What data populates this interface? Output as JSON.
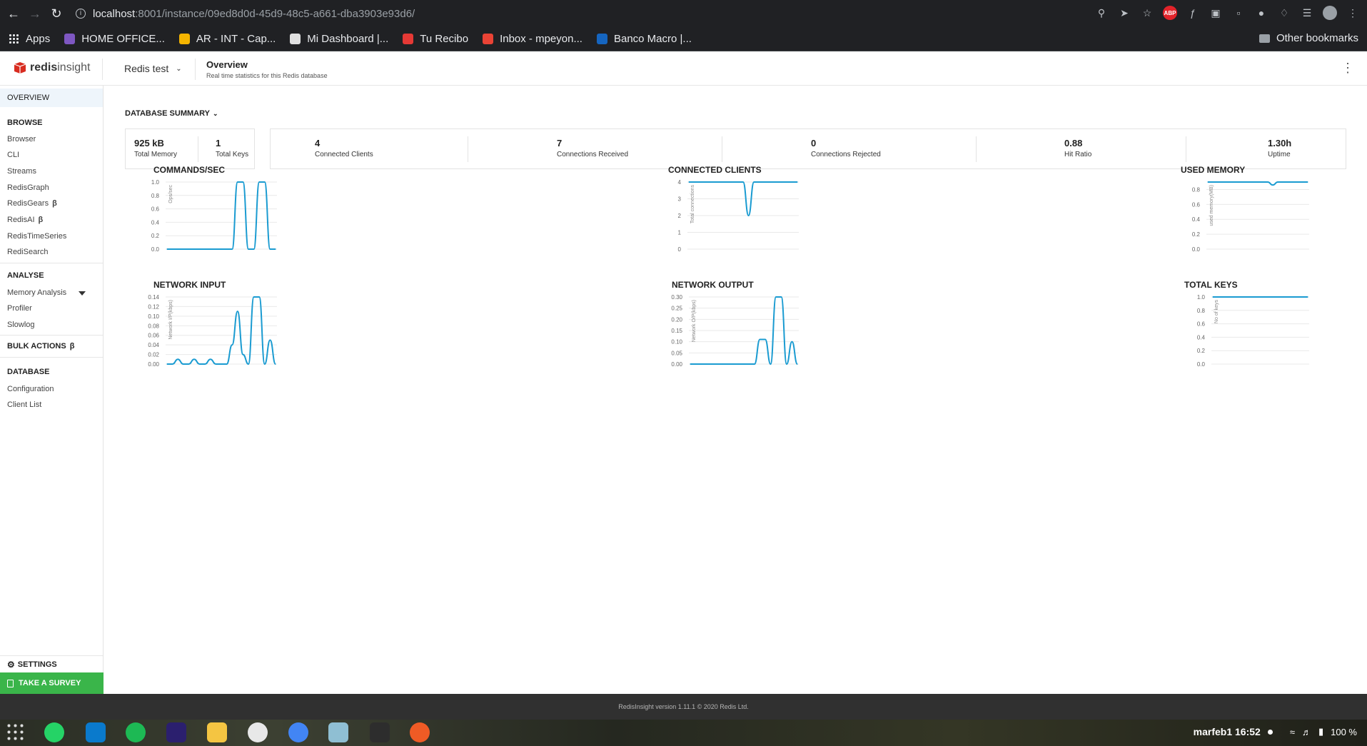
{
  "browser": {
    "url_host": "localhost",
    "url_path": ":8001/instance/09ed8d0d-45d9-48c5-a661-dba3903e93d6/",
    "extensions": [
      "search-icon",
      "send-icon",
      "star-icon",
      "adblock-icon",
      "script-icon",
      "screenshot-icon",
      "page-icon",
      "avatar-ext-icon",
      "puzzle-icon",
      "reading-list-icon",
      "profile-icon",
      "menu-icon"
    ],
    "abp_label": "ABP",
    "bookmarks": [
      {
        "label": "Apps",
        "color": "#e8eaed"
      },
      {
        "label": "HOME OFFICE...",
        "color": "#7e57c2"
      },
      {
        "label": "AR - INT - Cap...",
        "color": "#f4b400"
      },
      {
        "label": "Mi Dashboard |...",
        "color": "#e0e0e0"
      },
      {
        "label": "Tu Recibo",
        "color": "#e53935"
      },
      {
        "label": "Inbox - mpeyon...",
        "color": "#ea4335"
      },
      {
        "label": "Banco Macro |...",
        "color": "#1565c0"
      }
    ],
    "other_bookmarks": "Other bookmarks"
  },
  "header": {
    "logo_bold": "redis",
    "logo_light": "insight",
    "database": "Redis test",
    "title": "Overview",
    "subtitle": "Real time statistics for this Redis database"
  },
  "sidebar": {
    "overview": "OVERVIEW",
    "browse_title": "BROWSE",
    "browse_items": [
      "Browser",
      "CLI",
      "Streams",
      "RedisGraph",
      "RedisGears",
      "RedisAI",
      "RedisTimeSeries",
      "RediSearch"
    ],
    "beta": "β",
    "analyse_title": "ANALYSE",
    "analyse_items": [
      "Memory Analysis",
      "Profiler",
      "Slowlog"
    ],
    "bulk_actions": "BULK ACTIONS",
    "database_title": "DATABASE",
    "database_items": [
      "Configuration",
      "Client List"
    ],
    "settings": "SETTINGS",
    "survey": "TAKE A SURVEY"
  },
  "summary": {
    "title": "DATABASE SUMMARY",
    "memory": {
      "value": "925 kB",
      "label": "Total Memory"
    },
    "keys": {
      "value": "1",
      "label": "Total Keys"
    },
    "stats": [
      {
        "value": "4",
        "label": "Connected Clients"
      },
      {
        "value": "7",
        "label": "Connections Received"
      },
      {
        "value": "0",
        "label": "Connections Rejected"
      },
      {
        "value": "0.88",
        "label": "Hit Ratio"
      },
      {
        "value": "1.30h",
        "label": "Uptime"
      }
    ]
  },
  "accent_color": "#1a9bd1",
  "chart_data": [
    {
      "type": "line",
      "title": "COMMANDS/SEC",
      "ylabel": "Ops/sec",
      "ylim": [
        0,
        1.0
      ],
      "yticks": [
        "1.0",
        "0.8",
        "0.6",
        "0.4",
        "0.2",
        "0.0"
      ],
      "x": [
        0,
        1,
        2,
        3,
        4,
        5,
        6,
        7,
        8,
        9,
        10,
        11,
        12,
        13,
        14,
        15,
        16,
        17,
        18,
        19,
        20
      ],
      "values": [
        0,
        0,
        0,
        0,
        0,
        0,
        0,
        0,
        0,
        0,
        0,
        0,
        0,
        1,
        1,
        0,
        0,
        1,
        1,
        0,
        0
      ]
    },
    {
      "type": "line",
      "title": "CONNECTED CLIENTS",
      "ylabel": "Total connections",
      "ylim": [
        0,
        4
      ],
      "yticks": [
        "4",
        "3",
        "2",
        "1",
        "0"
      ],
      "x": [
        0,
        1,
        2,
        3,
        4,
        5,
        6,
        7,
        8,
        9,
        10,
        11,
        12,
        13,
        14,
        15,
        16,
        17,
        18,
        19,
        20
      ],
      "values": [
        4,
        4,
        4,
        4,
        4,
        4,
        4,
        4,
        4,
        4,
        4,
        2,
        4,
        4,
        4,
        4,
        4,
        4,
        4,
        4,
        4
      ]
    },
    {
      "type": "line",
      "title": "USED MEMORY",
      "ylabel": "used memory(MB)",
      "ylim": [
        0,
        0.9
      ],
      "yticks": [
        "0.8",
        "0.6",
        "0.4",
        "0.2",
        "0.0"
      ],
      "x": [
        0,
        1,
        2,
        3,
        4,
        5,
        6,
        7,
        8,
        9,
        10,
        11,
        12,
        13,
        14,
        15,
        16,
        17,
        18,
        19,
        20
      ],
      "values": [
        0.9,
        0.9,
        0.9,
        0.9,
        0.9,
        0.9,
        0.9,
        0.9,
        0.9,
        0.9,
        0.9,
        0.9,
        0.9,
        0.86,
        0.9,
        0.9,
        0.9,
        0.9,
        0.9,
        0.9,
        0.9
      ]
    },
    {
      "type": "line",
      "title": "NETWORK INPUT",
      "ylabel": "Network I/P(kbps)",
      "ylim": [
        0,
        0.14
      ],
      "yticks": [
        "0.14",
        "0.12",
        "0.10",
        "0.08",
        "0.06",
        "0.04",
        "0.02",
        "0.00"
      ],
      "x": [
        0,
        1,
        2,
        3,
        4,
        5,
        6,
        7,
        8,
        9,
        10,
        11,
        12,
        13,
        14,
        15,
        16,
        17,
        18,
        19,
        20
      ],
      "values": [
        0,
        0,
        0.01,
        0,
        0,
        0.01,
        0,
        0,
        0.01,
        0,
        0,
        0,
        0.04,
        0.11,
        0.02,
        0,
        0.14,
        0.14,
        0,
        0.05,
        0
      ]
    },
    {
      "type": "line",
      "title": "NETWORK OUTPUT",
      "ylabel": "Network O/P(kbps)",
      "ylim": [
        0,
        0.3
      ],
      "yticks": [
        "0.30",
        "0.25",
        "0.20",
        "0.15",
        "0.10",
        "0.05",
        "0.00"
      ],
      "x": [
        0,
        1,
        2,
        3,
        4,
        5,
        6,
        7,
        8,
        9,
        10,
        11,
        12,
        13,
        14,
        15,
        16,
        17,
        18,
        19,
        20
      ],
      "values": [
        0,
        0,
        0,
        0,
        0,
        0,
        0,
        0,
        0,
        0,
        0,
        0,
        0,
        0.11,
        0.11,
        0,
        0.3,
        0.3,
        0,
        0.1,
        0
      ]
    },
    {
      "type": "line",
      "title": "TOTAL KEYS",
      "ylabel": "No of keys",
      "ylim": [
        0,
        1.0
      ],
      "yticks": [
        "1.0",
        "0.8",
        "0.6",
        "0.4",
        "0.2",
        "0.0"
      ],
      "x": [
        0,
        1,
        2,
        3,
        4,
        5,
        6,
        7,
        8,
        9,
        10,
        11,
        12,
        13,
        14,
        15,
        16,
        17,
        18,
        19,
        20
      ],
      "values": [
        1,
        1,
        1,
        1,
        1,
        1,
        1,
        1,
        1,
        1,
        1,
        1,
        1,
        1,
        1,
        1,
        1,
        1,
        1,
        1,
        1
      ]
    }
  ],
  "footer": "RedisInsight version 1.11.1 © 2020 Redis Ltd.",
  "taskbar": {
    "apps": [
      {
        "name": "app-grid-icon",
        "color": "#3a3a3a"
      },
      {
        "name": "whatsapp-icon",
        "color": "#25d366"
      },
      {
        "name": "vscode-icon",
        "color": "#0a7acc"
      },
      {
        "name": "spotify-icon",
        "color": "#1db954"
      },
      {
        "name": "intellij-icon",
        "color": "#2b1f6e"
      },
      {
        "name": "files-icon",
        "color": "#f4c542"
      },
      {
        "name": "slack-icon",
        "color": "#e8e8e8"
      },
      {
        "name": "chrome-icon",
        "color": "#4285f4"
      },
      {
        "name": "notes-icon",
        "color": "#8fbfd3"
      },
      {
        "name": "terminal-icon",
        "color": "#2d2d2d"
      },
      {
        "name": "postman-icon",
        "color": "#ef5b25"
      }
    ],
    "datetime": "marfeb1 16:52",
    "battery": "100 %"
  }
}
